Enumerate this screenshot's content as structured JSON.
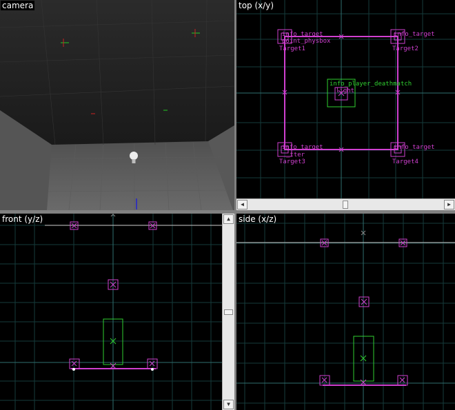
{
  "viewports": {
    "camera": {
      "title": "camera"
    },
    "top": {
      "title": "top (x/y)"
    },
    "front": {
      "title": "front (y/z)"
    },
    "side": {
      "title": "side (x/z)"
    }
  },
  "entities": {
    "top_left_1": "info_target",
    "top_left_2": "point_physbox",
    "top_left_3": "Target1",
    "top_right_1": "info_target",
    "top_right_3": "Target2",
    "bottom_left_1": "info_target",
    "bottom_left_2": "_tter",
    "bottom_left_3": "Target3",
    "bottom_right_1": "info_target",
    "bottom_right_3": "Target4",
    "deathmatch": "info_player_deathmatch",
    "light": "light"
  },
  "icons": {
    "light_bulb": "light-bulb-icon",
    "scroll_left": "arrow-left-icon",
    "scroll_right": "arrow-right-icon",
    "scroll_up": "arrow-up-icon",
    "scroll_down": "arrow-down-icon"
  },
  "colors": {
    "entity": "#d040d0",
    "player": "#30d030",
    "grid": "#163b3b",
    "axis": "#2f6f6f",
    "viewport_bg": "#000000",
    "camera_floor": "#4a4a4a"
  }
}
